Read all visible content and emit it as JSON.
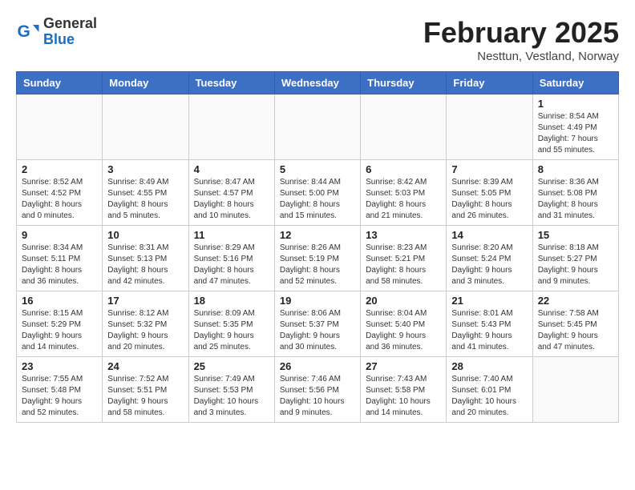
{
  "header": {
    "logo_general": "General",
    "logo_blue": "Blue",
    "month_title": "February 2025",
    "location": "Nesttun, Vestland, Norway"
  },
  "calendar": {
    "days_of_week": [
      "Sunday",
      "Monday",
      "Tuesday",
      "Wednesday",
      "Thursday",
      "Friday",
      "Saturday"
    ],
    "weeks": [
      [
        {
          "day": "",
          "info": ""
        },
        {
          "day": "",
          "info": ""
        },
        {
          "day": "",
          "info": ""
        },
        {
          "day": "",
          "info": ""
        },
        {
          "day": "",
          "info": ""
        },
        {
          "day": "",
          "info": ""
        },
        {
          "day": "1",
          "info": "Sunrise: 8:54 AM\nSunset: 4:49 PM\nDaylight: 7 hours\nand 55 minutes."
        }
      ],
      [
        {
          "day": "2",
          "info": "Sunrise: 8:52 AM\nSunset: 4:52 PM\nDaylight: 8 hours\nand 0 minutes."
        },
        {
          "day": "3",
          "info": "Sunrise: 8:49 AM\nSunset: 4:55 PM\nDaylight: 8 hours\nand 5 minutes."
        },
        {
          "day": "4",
          "info": "Sunrise: 8:47 AM\nSunset: 4:57 PM\nDaylight: 8 hours\nand 10 minutes."
        },
        {
          "day": "5",
          "info": "Sunrise: 8:44 AM\nSunset: 5:00 PM\nDaylight: 8 hours\nand 15 minutes."
        },
        {
          "day": "6",
          "info": "Sunrise: 8:42 AM\nSunset: 5:03 PM\nDaylight: 8 hours\nand 21 minutes."
        },
        {
          "day": "7",
          "info": "Sunrise: 8:39 AM\nSunset: 5:05 PM\nDaylight: 8 hours\nand 26 minutes."
        },
        {
          "day": "8",
          "info": "Sunrise: 8:36 AM\nSunset: 5:08 PM\nDaylight: 8 hours\nand 31 minutes."
        }
      ],
      [
        {
          "day": "9",
          "info": "Sunrise: 8:34 AM\nSunset: 5:11 PM\nDaylight: 8 hours\nand 36 minutes."
        },
        {
          "day": "10",
          "info": "Sunrise: 8:31 AM\nSunset: 5:13 PM\nDaylight: 8 hours\nand 42 minutes."
        },
        {
          "day": "11",
          "info": "Sunrise: 8:29 AM\nSunset: 5:16 PM\nDaylight: 8 hours\nand 47 minutes."
        },
        {
          "day": "12",
          "info": "Sunrise: 8:26 AM\nSunset: 5:19 PM\nDaylight: 8 hours\nand 52 minutes."
        },
        {
          "day": "13",
          "info": "Sunrise: 8:23 AM\nSunset: 5:21 PM\nDaylight: 8 hours\nand 58 minutes."
        },
        {
          "day": "14",
          "info": "Sunrise: 8:20 AM\nSunset: 5:24 PM\nDaylight: 9 hours\nand 3 minutes."
        },
        {
          "day": "15",
          "info": "Sunrise: 8:18 AM\nSunset: 5:27 PM\nDaylight: 9 hours\nand 9 minutes."
        }
      ],
      [
        {
          "day": "16",
          "info": "Sunrise: 8:15 AM\nSunset: 5:29 PM\nDaylight: 9 hours\nand 14 minutes."
        },
        {
          "day": "17",
          "info": "Sunrise: 8:12 AM\nSunset: 5:32 PM\nDaylight: 9 hours\nand 20 minutes."
        },
        {
          "day": "18",
          "info": "Sunrise: 8:09 AM\nSunset: 5:35 PM\nDaylight: 9 hours\nand 25 minutes."
        },
        {
          "day": "19",
          "info": "Sunrise: 8:06 AM\nSunset: 5:37 PM\nDaylight: 9 hours\nand 30 minutes."
        },
        {
          "day": "20",
          "info": "Sunrise: 8:04 AM\nSunset: 5:40 PM\nDaylight: 9 hours\nand 36 minutes."
        },
        {
          "day": "21",
          "info": "Sunrise: 8:01 AM\nSunset: 5:43 PM\nDaylight: 9 hours\nand 41 minutes."
        },
        {
          "day": "22",
          "info": "Sunrise: 7:58 AM\nSunset: 5:45 PM\nDaylight: 9 hours\nand 47 minutes."
        }
      ],
      [
        {
          "day": "23",
          "info": "Sunrise: 7:55 AM\nSunset: 5:48 PM\nDaylight: 9 hours\nand 52 minutes."
        },
        {
          "day": "24",
          "info": "Sunrise: 7:52 AM\nSunset: 5:51 PM\nDaylight: 9 hours\nand 58 minutes."
        },
        {
          "day": "25",
          "info": "Sunrise: 7:49 AM\nSunset: 5:53 PM\nDaylight: 10 hours\nand 3 minutes."
        },
        {
          "day": "26",
          "info": "Sunrise: 7:46 AM\nSunset: 5:56 PM\nDaylight: 10 hours\nand 9 minutes."
        },
        {
          "day": "27",
          "info": "Sunrise: 7:43 AM\nSunset: 5:58 PM\nDaylight: 10 hours\nand 14 minutes."
        },
        {
          "day": "28",
          "info": "Sunrise: 7:40 AM\nSunset: 6:01 PM\nDaylight: 10 hours\nand 20 minutes."
        },
        {
          "day": "",
          "info": ""
        }
      ]
    ]
  }
}
